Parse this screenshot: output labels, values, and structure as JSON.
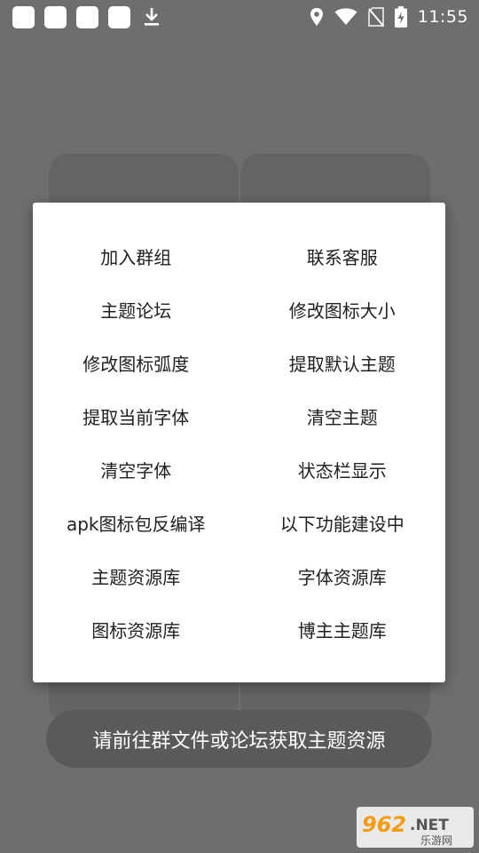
{
  "status_bar": {
    "time": "11:55",
    "notification_icons": [
      "app-notification",
      "app-notification",
      "app-notification",
      "app-notification",
      "download"
    ],
    "system_icons": [
      "location-icon",
      "wifi-icon",
      "no-sim-icon",
      "battery-charging-icon"
    ]
  },
  "dialog": {
    "items": [
      {
        "label": "加入群组"
      },
      {
        "label": "联系客服"
      },
      {
        "label": "主题论坛"
      },
      {
        "label": "修改图标大小"
      },
      {
        "label": "修改图标弧度"
      },
      {
        "label": "提取默认主题"
      },
      {
        "label": "提取当前字体"
      },
      {
        "label": "清空主题"
      },
      {
        "label": "清空字体"
      },
      {
        "label": "状态栏显示"
      },
      {
        "label": "apk图标包反编译"
      },
      {
        "label": "以下功能建设中"
      },
      {
        "label": "主题资源库"
      },
      {
        "label": "字体资源库"
      },
      {
        "label": "图标资源库"
      },
      {
        "label": "博主主题库"
      }
    ]
  },
  "info_pill": {
    "text": "请前往群文件或论坛获取主题资源"
  },
  "watermark": {
    "brand": "962.NET",
    "subtitle": "乐游网"
  },
  "colors": {
    "scrim": "#6e6e6e",
    "dialog_bg": "#ffffff",
    "text_primary": "#212121",
    "pill_bg": "#5a5a5a",
    "watermark_orange": "#f39c12"
  }
}
